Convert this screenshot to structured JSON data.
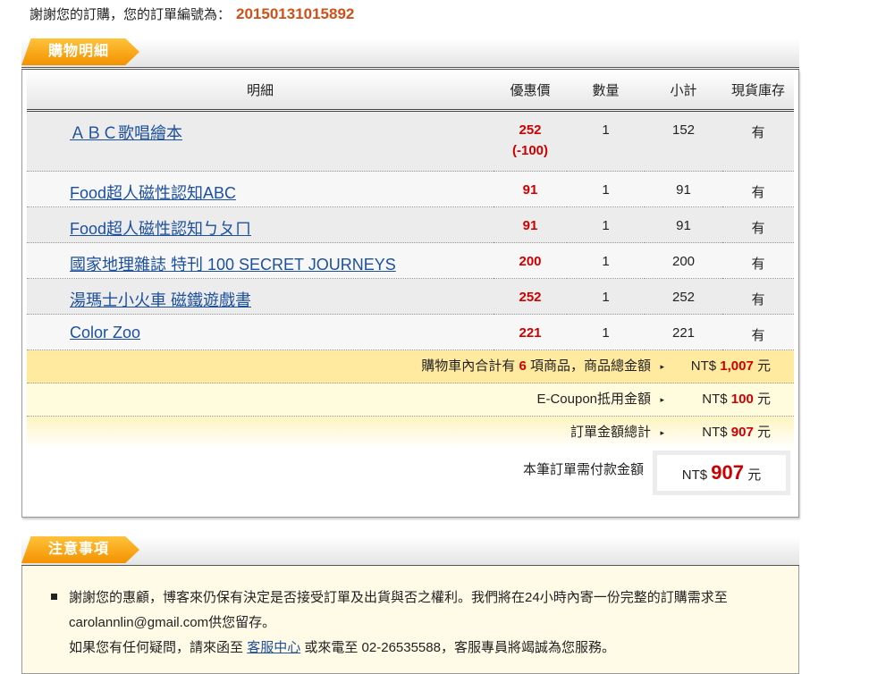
{
  "thanks": {
    "text": "謝謝您的訂購，您的訂單編號為：",
    "order_no": "20150131015892"
  },
  "cart": {
    "title": "購物明細",
    "headers": {
      "item": "明細",
      "price": "優惠價",
      "qty": "數量",
      "subtotal": "小計",
      "stock": "現貨庫存"
    },
    "items": [
      {
        "name": "ＡＢＣ歌唱繪本",
        "price": "252",
        "discount": "(-100)",
        "qty": "1",
        "subtotal": "152",
        "stock": "有"
      },
      {
        "name": "Food超人磁性認知ABC",
        "price": "91",
        "qty": "1",
        "subtotal": "91",
        "stock": "有"
      },
      {
        "name": "Food超人磁性認知ㄅㄆㄇ",
        "price": "91",
        "qty": "1",
        "subtotal": "91",
        "stock": "有"
      },
      {
        "name": "國家地理雜誌 特刊 100 SECRET JOURNEYS",
        "price": "200",
        "qty": "1",
        "subtotal": "200",
        "stock": "有"
      },
      {
        "name": "湯瑪士小火車 磁鐵遊戲書",
        "price": "252",
        "qty": "1",
        "subtotal": "252",
        "stock": "有"
      },
      {
        "name": "Color Zoo",
        "price": "221",
        "qty": "1",
        "subtotal": "221",
        "stock": "有"
      }
    ],
    "summary": {
      "count_pre": "購物車內合計有",
      "count": "6",
      "count_post": "項商品，商品總金額",
      "arrow": "▸",
      "currency": "NT$",
      "total": "1,007",
      "unit": "元",
      "coupon_label": "E-Coupon抵用金額",
      "coupon": "100",
      "order_label": "訂單金額總計",
      "order_total": "907",
      "pay_label": "本筆訂單需付款金額",
      "pay_amount": "907"
    }
  },
  "notice": {
    "title": "注意事項",
    "line1": "謝謝您的惠顧，博客來仍保有決定是否接受訂單及出貨與否之權利。我們將在24小時內寄一份完整的訂購需求至carolannlin@gmail.com供您留存。",
    "line2_pre": "如果您有任何疑問，請來函至",
    "link": "客服中心",
    "line2_post": "或來電至 02-26535588，客服專員將竭誠為您服務。"
  }
}
